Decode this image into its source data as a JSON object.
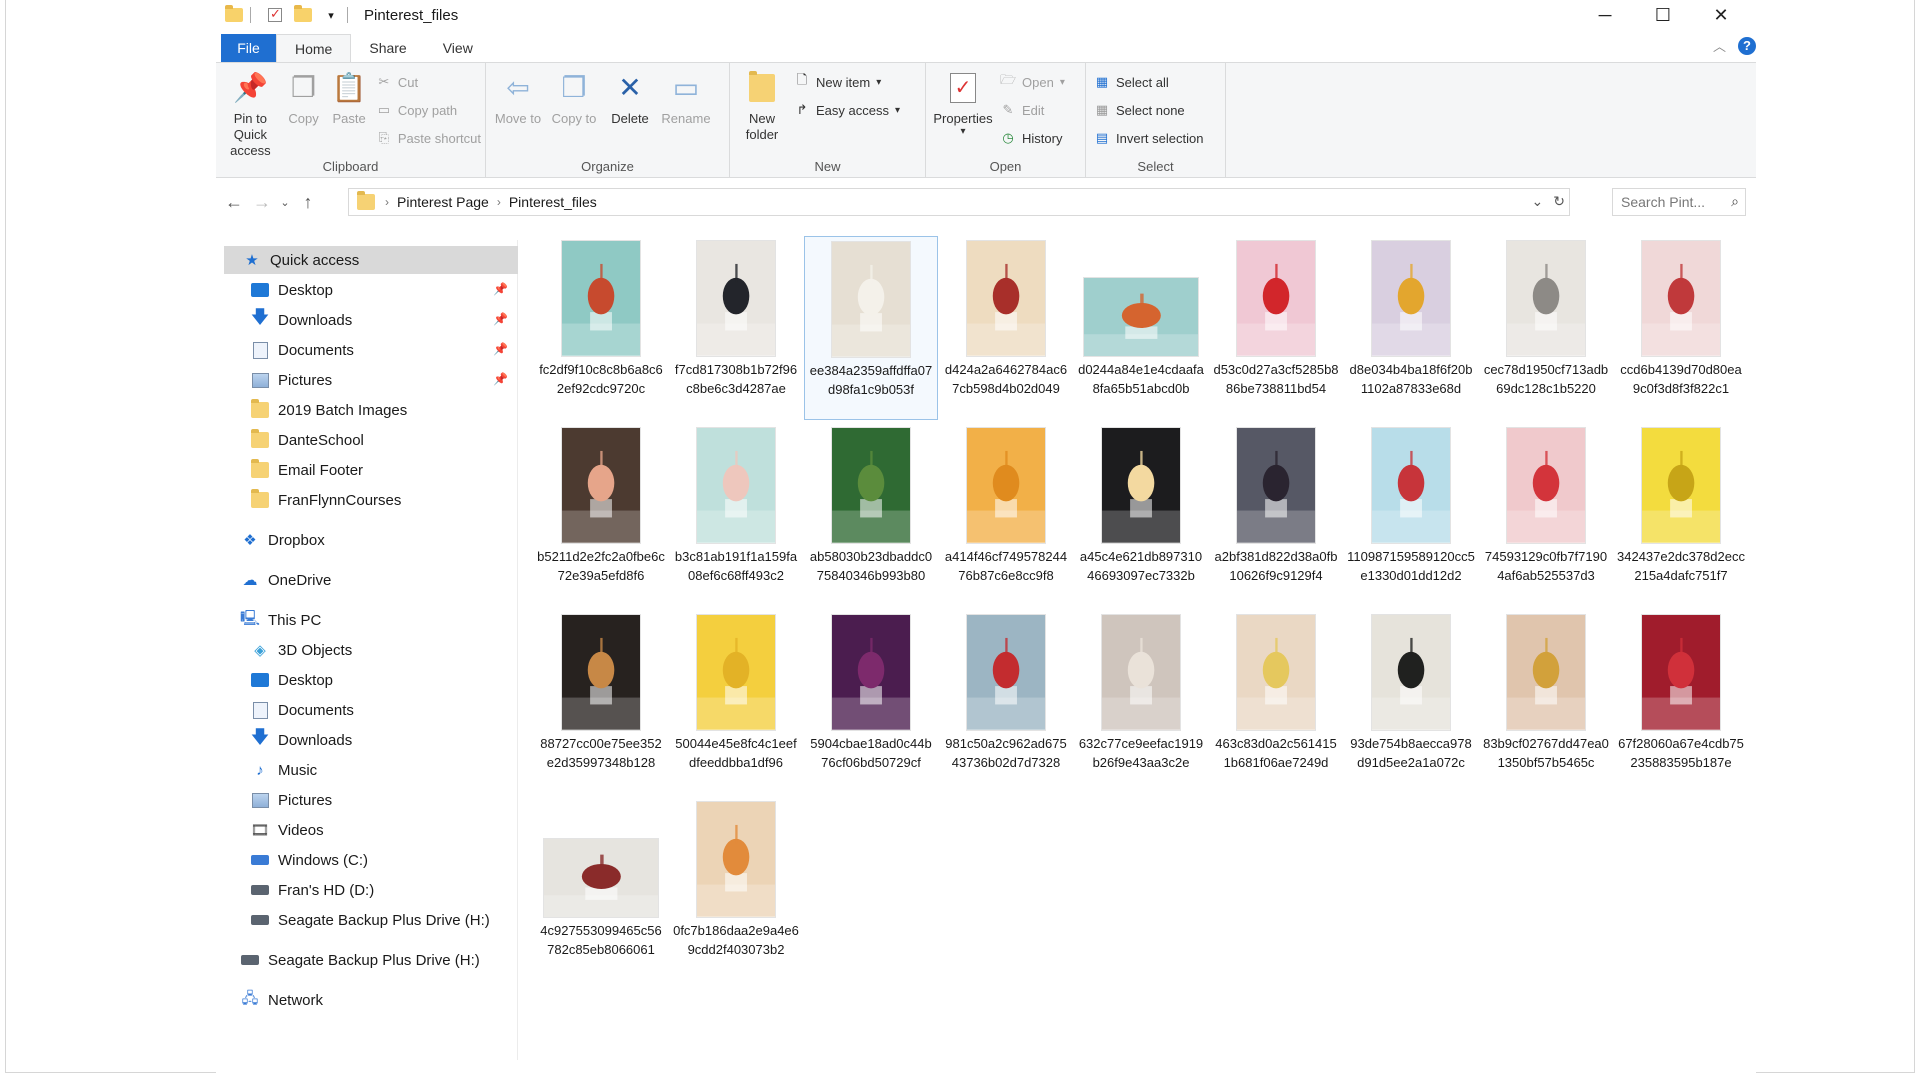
{
  "window": {
    "title": "Pinterest_files"
  },
  "tabs": [
    {
      "label": "File"
    },
    {
      "label": "Home"
    },
    {
      "label": "Share"
    },
    {
      "label": "View"
    }
  ],
  "ribbon": {
    "clipboard": {
      "label": "Clipboard",
      "pin": "Pin to Quick access",
      "copy": "Copy",
      "paste": "Paste",
      "cut": "Cut",
      "copy_path": "Copy path",
      "paste_shortcut": "Paste shortcut"
    },
    "organize": {
      "label": "Organize",
      "move_to": "Move to",
      "copy_to": "Copy to",
      "delete": "Delete",
      "rename": "Rename"
    },
    "new": {
      "label": "New",
      "new_folder": "New folder",
      "new_item": "New item",
      "easy_access": "Easy access"
    },
    "open": {
      "label": "Open",
      "properties": "Properties",
      "open": "Open",
      "edit": "Edit",
      "history": "History"
    },
    "select": {
      "label": "Select",
      "select_all": "Select all",
      "select_none": "Select none",
      "invert": "Invert selection"
    }
  },
  "address": {
    "crumbs": [
      "Pinterest Page",
      "Pinterest_files"
    ],
    "search_placeholder": "Search Pint..."
  },
  "sidebar": {
    "quick_access": "Quick access",
    "quick_items": [
      {
        "label": "Desktop",
        "pinned": true
      },
      {
        "label": "Downloads",
        "pinned": true
      },
      {
        "label": "Documents",
        "pinned": true
      },
      {
        "label": "Pictures",
        "pinned": true
      },
      {
        "label": "2019 Batch Images"
      },
      {
        "label": "DanteSchool"
      },
      {
        "label": "Email Footer"
      },
      {
        "label": "FranFlynnCourses"
      }
    ],
    "dropbox": "Dropbox",
    "onedrive": "OneDrive",
    "this_pc": "This PC",
    "pc_items": [
      "3D Objects",
      "Desktop",
      "Documents",
      "Downloads",
      "Music",
      "Pictures",
      "Videos",
      "Windows (C:)",
      "Fran's HD (D:)",
      "Seagate Backup Plus Drive (H:)"
    ],
    "seagate": "Seagate Backup Plus Drive (H:)",
    "network": "Network"
  },
  "files": [
    {
      "name": "fc2df9f10c8c8b6a8c62ef92cdc9720c",
      "bg": "#8fc9c4",
      "fg": "#c74a2e",
      "w": 64,
      "h": 94
    },
    {
      "name": "f7cd817308b1b72f96c8be6c3d4287ae",
      "bg": "#e9e6e1",
      "fg": "#23252b",
      "w": 64,
      "h": 94
    },
    {
      "name": "ee384a2359affdffa07d98fa1c9b053f",
      "bg": "#e6dfd3",
      "fg": "#f4f1ea",
      "w": 64,
      "h": 94,
      "selected": true
    },
    {
      "name": "d424a2a6462784ac67cb598d4b02d049",
      "bg": "#eedcc0",
      "fg": "#a82f2a",
      "w": 64,
      "h": 94
    },
    {
      "name": "d0244a84e1e4cdaafa8fa65b51abcd0b",
      "bg": "#9fcfcd",
      "fg": "#d5642f",
      "w": 94,
      "h": 64
    },
    {
      "name": "d53c0d27a3cf5285b886be738811bd54",
      "bg": "#f0c8d4",
      "fg": "#d2262b",
      "w": 64,
      "h": 94
    },
    {
      "name": "d8e034b4ba18f6f20b1102a87833e68d",
      "bg": "#d9cfe0",
      "fg": "#e3a62e",
      "w": 64,
      "h": 94
    },
    {
      "name": "cec78d1950cf713adb69dc128c1b5220",
      "bg": "#e8e5e0",
      "fg": "#8d8a86",
      "w": 64,
      "h": 94
    },
    {
      "name": "ccd6b4139d70d80ea9c0f3d8f3f822c1",
      "bg": "#f0d8d8",
      "fg": "#c0393b",
      "w": 64,
      "h": 94
    },
    {
      "name": "b5211d2e2fc2a0fbe6c72e39a5efd8f6",
      "bg": "#4c3a30",
      "fg": "#e6a58a",
      "w": 64,
      "h": 94
    },
    {
      "name": "b3c81ab191f1a159fa08ef6c68ff493c2",
      "bg": "#bfe0dc",
      "fg": "#eec7bd",
      "w": 64,
      "h": 94
    },
    {
      "name": "ab58030b23dbaddc075840346b993b80",
      "bg": "#2f6a33",
      "fg": "#5b8c3c",
      "w": 64,
      "h": 94
    },
    {
      "name": "a414f46cf74957824476b87c6e8cc9f8",
      "bg": "#f2b048",
      "fg": "#e08b1e",
      "w": 64,
      "h": 94
    },
    {
      "name": "a45c4e621db89731046693097ec7332b",
      "bg": "#1c1c1e",
      "fg": "#f3d9a0",
      "w": 64,
      "h": 94
    },
    {
      "name": "a2bf381d822d38a0fb10626f9c9129f4",
      "bg": "#565865",
      "fg": "#2a2430",
      "w": 64,
      "h": 94
    },
    {
      "name": "110987159589120cc5e1330d01dd12d2",
      "bg": "#b8dde9",
      "fg": "#c7343a",
      "w": 64,
      "h": 94
    },
    {
      "name": "74593129c0fb7f71904af6ab525537d3",
      "bg": "#f0c9cc",
      "fg": "#d3343b",
      "w": 64,
      "h": 94
    },
    {
      "name": "342437e2dc378d2ecc215a4dafc751f7",
      "bg": "#f3dc3e",
      "fg": "#c7a517",
      "w": 64,
      "h": 94
    },
    {
      "name": "88727cc00e75ee352e2d35997348b128",
      "bg": "#27221f",
      "fg": "#c78846",
      "w": 64,
      "h": 94
    },
    {
      "name": "50044e45e8fc4c1eefdfeeddbba1df96",
      "bg": "#f4cf3e",
      "fg": "#e3b226",
      "w": 64,
      "h": 94
    },
    {
      "name": "5904cbae18ad0c44b76cf06bd50729cf",
      "bg": "#4b1d4f",
      "fg": "#7d2a6c",
      "w": 64,
      "h": 94
    },
    {
      "name": "981c50a2c962ad67543736b02d7d7328",
      "bg": "#9cb5c3",
      "fg": "#c32c2f",
      "w": 64,
      "h": 94
    },
    {
      "name": "632c77ce9eefac1919b26f9e43aa3c2e",
      "bg": "#cfc5bd",
      "fg": "#eae2d9",
      "w": 64,
      "h": 94
    },
    {
      "name": "463c83d0a2c5614151b681f06ae7249d",
      "bg": "#ead8c4",
      "fg": "#e5c85e",
      "w": 64,
      "h": 94
    },
    {
      "name": "93de754b8aecca978d91d5ee2a1a072c",
      "bg": "#e6e3db",
      "fg": "#20211f",
      "w": 64,
      "h": 94
    },
    {
      "name": "83b9cf02767dd47ea01350bf57b5465c",
      "bg": "#e0c5ad",
      "fg": "#d2a13b",
      "w": 64,
      "h": 94
    },
    {
      "name": "67f28060a67e4cdb75235883595b187e",
      "bg": "#a01c2c",
      "fg": "#d0303a",
      "w": 64,
      "h": 94
    },
    {
      "name": "4c927553099465c56782c85eb8066061",
      "bg": "#e6e4df",
      "fg": "#8a2b2a",
      "w": 94,
      "h": 64
    },
    {
      "name": "0fc7b186daa2e9a4e69cdd2f403073b2",
      "bg": "#ecd4b6",
      "fg": "#e28b3b",
      "w": 64,
      "h": 94
    }
  ]
}
